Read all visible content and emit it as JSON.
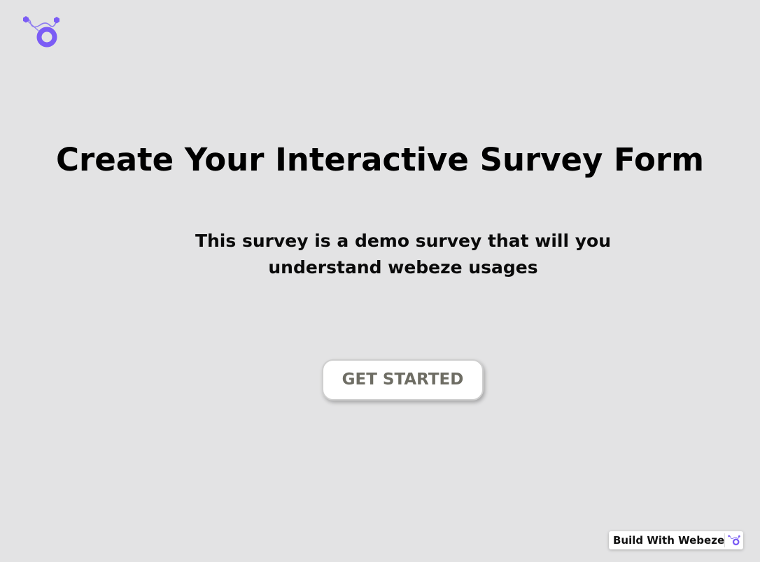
{
  "brand": {
    "logo_icon": "webeze-logo-icon",
    "accent_color": "#7b5cf5"
  },
  "hero": {
    "title": "Create Your Interactive Survey Form",
    "subtitle": "This survey is a demo survey that will you understand webeze usages"
  },
  "cta": {
    "label": "GET STARTED"
  },
  "badge": {
    "label": "Build With Webeze",
    "icon": "webeze-logo-icon"
  }
}
